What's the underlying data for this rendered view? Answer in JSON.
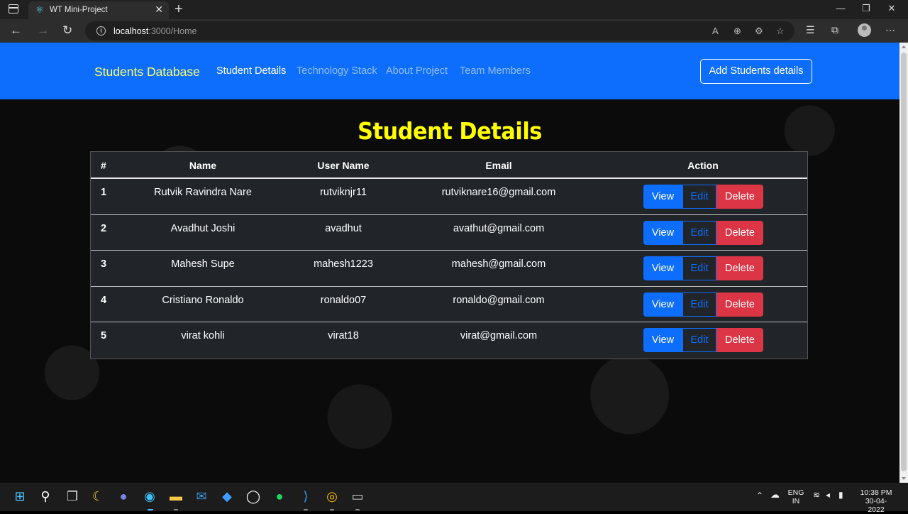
{
  "browser": {
    "tab_title": "WT Mini-Project",
    "url_host": "localhost",
    "url_path": ":3000/Home"
  },
  "navbar": {
    "brand": "Students Database",
    "links": [
      "Student Details",
      "Technology Stack",
      "About Project",
      "Team Members"
    ],
    "active_link": "Student Details",
    "add_button": "Add Students details"
  },
  "main": {
    "heading": "Student Details",
    "columns": [
      "#",
      "Name",
      "User Name",
      "Email",
      "Action"
    ],
    "rows": [
      {
        "id": "1",
        "name": "Rutvik Ravindra Nare",
        "username": "rutviknjr11",
        "email": "rutviknare16@gmail.com"
      },
      {
        "id": "2",
        "name": "Avadhut Joshi",
        "username": "avadhut",
        "email": "avathut@gmail.com"
      },
      {
        "id": "3",
        "name": "Mahesh Supe",
        "username": "mahesh1223",
        "email": "mahesh@gmail.com"
      },
      {
        "id": "4",
        "name": "Cristiano Ronaldo",
        "username": "ronaldo07",
        "email": "ronaldo@gmail.com"
      },
      {
        "id": "5",
        "name": "virat kohli",
        "username": "virat18",
        "email": "virat@gmail.com"
      }
    ],
    "actions": {
      "view": "View",
      "edit": "Edit",
      "delete": "Delete"
    }
  },
  "taskbar": {
    "language": "ENG",
    "region": "IN",
    "time": "10:38 PM",
    "date": "30-04-2022"
  },
  "colors": {
    "navbar_bg": "#0d6efd",
    "brand": "#ffff66",
    "heading": "#ffff00",
    "delete": "#dc3545"
  }
}
